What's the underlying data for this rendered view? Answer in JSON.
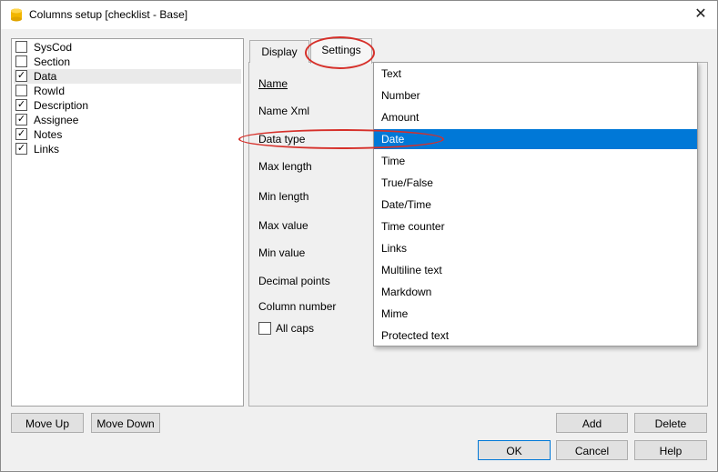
{
  "window": {
    "title": "Columns setup [checklist - Base]",
    "close_icon": "close-icon",
    "app_icon": "database-icon"
  },
  "columns": [
    {
      "label": "SysCod",
      "checked": false
    },
    {
      "label": "Section",
      "checked": false
    },
    {
      "label": "Data",
      "checked": true
    },
    {
      "label": "RowId",
      "checked": false
    },
    {
      "label": "Description",
      "checked": true
    },
    {
      "label": "Assignee",
      "checked": true
    },
    {
      "label": "Notes",
      "checked": true
    },
    {
      "label": "Links",
      "checked": true
    }
  ],
  "tabs": {
    "display": "Display",
    "settings": "Settings"
  },
  "fields": {
    "name": "Name",
    "name_xml": "Name Xml",
    "data_type": "Data type",
    "max_length": "Max length",
    "min_length": "Min length",
    "max_value": "Max value",
    "min_value": "Min value",
    "decimal_points": "Decimal points",
    "column_number": "Column number",
    "all_caps": "All caps"
  },
  "data_type_options": [
    "Text",
    "Number",
    "Amount",
    "Date",
    "Time",
    "True/False",
    "Date/Time",
    "Time counter",
    "Links",
    "Multiline text",
    "Markdown",
    "Mime",
    "Protected text"
  ],
  "selected_data_type": "Date",
  "buttons": {
    "move_up": "Move Up",
    "move_down": "Move Down",
    "add": "Add",
    "delete": "Delete",
    "ok": "OK",
    "cancel": "Cancel",
    "help": "Help"
  },
  "colors": {
    "selection": "#0078d7",
    "annotation": "#d6302a"
  }
}
